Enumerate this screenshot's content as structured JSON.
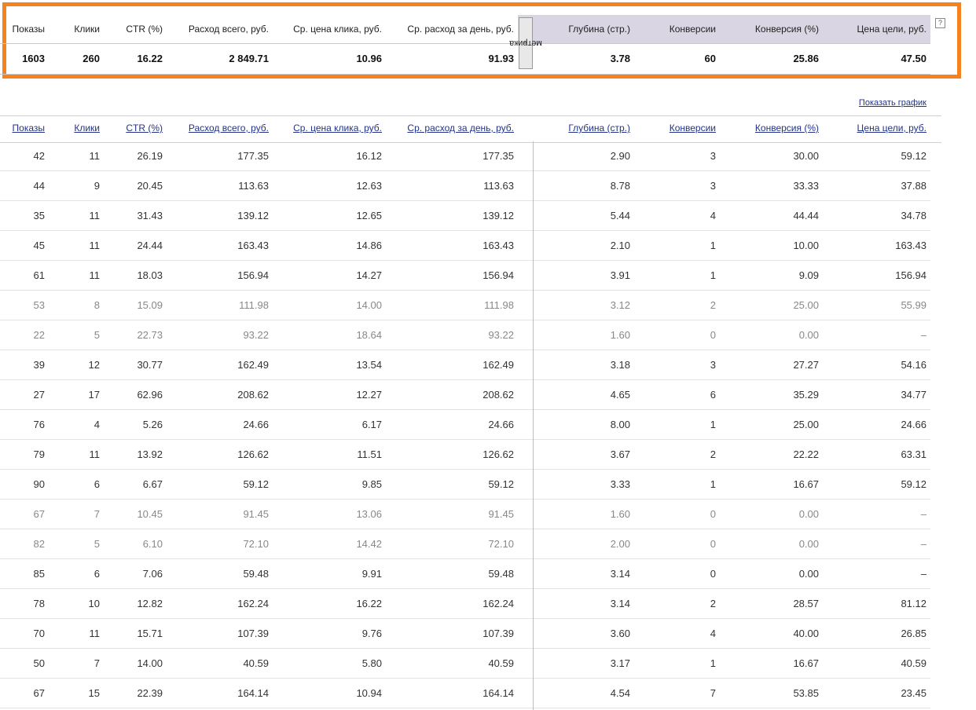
{
  "columns": [
    "Показы",
    "Клики",
    "CTR (%)",
    "Расход всего, руб.",
    "Ср. цена клика, руб.",
    "Ср. расход за день, руб.",
    "Глубина (стр.)",
    "Конверсии",
    "Конверсия (%)",
    "Цена цели, руб."
  ],
  "metrika_label": "метрика",
  "metrika_arrow": "»",
  "help_label": "?",
  "show_graph_label": "Показать график",
  "summary": [
    "1603",
    "260",
    "16.22",
    "2 849.71",
    "10.96",
    "91.93",
    "3.78",
    "60",
    "25.86",
    "47.50"
  ],
  "rows": [
    {
      "muted": false,
      "cells": [
        "42",
        "11",
        "26.19",
        "177.35",
        "16.12",
        "177.35",
        "2.90",
        "3",
        "30.00",
        "59.12"
      ]
    },
    {
      "muted": false,
      "cells": [
        "44",
        "9",
        "20.45",
        "113.63",
        "12.63",
        "113.63",
        "8.78",
        "3",
        "33.33",
        "37.88"
      ]
    },
    {
      "muted": false,
      "cells": [
        "35",
        "11",
        "31.43",
        "139.12",
        "12.65",
        "139.12",
        "5.44",
        "4",
        "44.44",
        "34.78"
      ]
    },
    {
      "muted": false,
      "cells": [
        "45",
        "11",
        "24.44",
        "163.43",
        "14.86",
        "163.43",
        "2.10",
        "1",
        "10.00",
        "163.43"
      ]
    },
    {
      "muted": false,
      "cells": [
        "61",
        "11",
        "18.03",
        "156.94",
        "14.27",
        "156.94",
        "3.91",
        "1",
        "9.09",
        "156.94"
      ]
    },
    {
      "muted": true,
      "cells": [
        "53",
        "8",
        "15.09",
        "111.98",
        "14.00",
        "111.98",
        "3.12",
        "2",
        "25.00",
        "55.99"
      ]
    },
    {
      "muted": true,
      "cells": [
        "22",
        "5",
        "22.73",
        "93.22",
        "18.64",
        "93.22",
        "1.60",
        "0",
        "0.00",
        "–"
      ]
    },
    {
      "muted": false,
      "cells": [
        "39",
        "12",
        "30.77",
        "162.49",
        "13.54",
        "162.49",
        "3.18",
        "3",
        "27.27",
        "54.16"
      ]
    },
    {
      "muted": false,
      "cells": [
        "27",
        "17",
        "62.96",
        "208.62",
        "12.27",
        "208.62",
        "4.65",
        "6",
        "35.29",
        "34.77"
      ]
    },
    {
      "muted": false,
      "cells": [
        "76",
        "4",
        "5.26",
        "24.66",
        "6.17",
        "24.66",
        "8.00",
        "1",
        "25.00",
        "24.66"
      ]
    },
    {
      "muted": false,
      "cells": [
        "79",
        "11",
        "13.92",
        "126.62",
        "11.51",
        "126.62",
        "3.67",
        "2",
        "22.22",
        "63.31"
      ]
    },
    {
      "muted": false,
      "cells": [
        "90",
        "6",
        "6.67",
        "59.12",
        "9.85",
        "59.12",
        "3.33",
        "1",
        "16.67",
        "59.12"
      ]
    },
    {
      "muted": true,
      "cells": [
        "67",
        "7",
        "10.45",
        "91.45",
        "13.06",
        "91.45",
        "1.60",
        "0",
        "0.00",
        "–"
      ]
    },
    {
      "muted": true,
      "cells": [
        "82",
        "5",
        "6.10",
        "72.10",
        "14.42",
        "72.10",
        "2.00",
        "0",
        "0.00",
        "–"
      ]
    },
    {
      "muted": false,
      "cells": [
        "85",
        "6",
        "7.06",
        "59.48",
        "9.91",
        "59.48",
        "3.14",
        "0",
        "0.00",
        "–"
      ]
    },
    {
      "muted": false,
      "cells": [
        "78",
        "10",
        "12.82",
        "162.24",
        "16.22",
        "162.24",
        "3.14",
        "2",
        "28.57",
        "81.12"
      ]
    },
    {
      "muted": false,
      "cells": [
        "70",
        "11",
        "15.71",
        "107.39",
        "9.76",
        "107.39",
        "3.60",
        "4",
        "40.00",
        "26.85"
      ]
    },
    {
      "muted": false,
      "cells": [
        "50",
        "7",
        "14.00",
        "40.59",
        "5.80",
        "40.59",
        "3.17",
        "1",
        "16.67",
        "40.59"
      ]
    },
    {
      "muted": false,
      "cells": [
        "67",
        "15",
        "22.39",
        "164.14",
        "10.94",
        "164.14",
        "4.54",
        "7",
        "53.85",
        "23.45"
      ]
    }
  ]
}
